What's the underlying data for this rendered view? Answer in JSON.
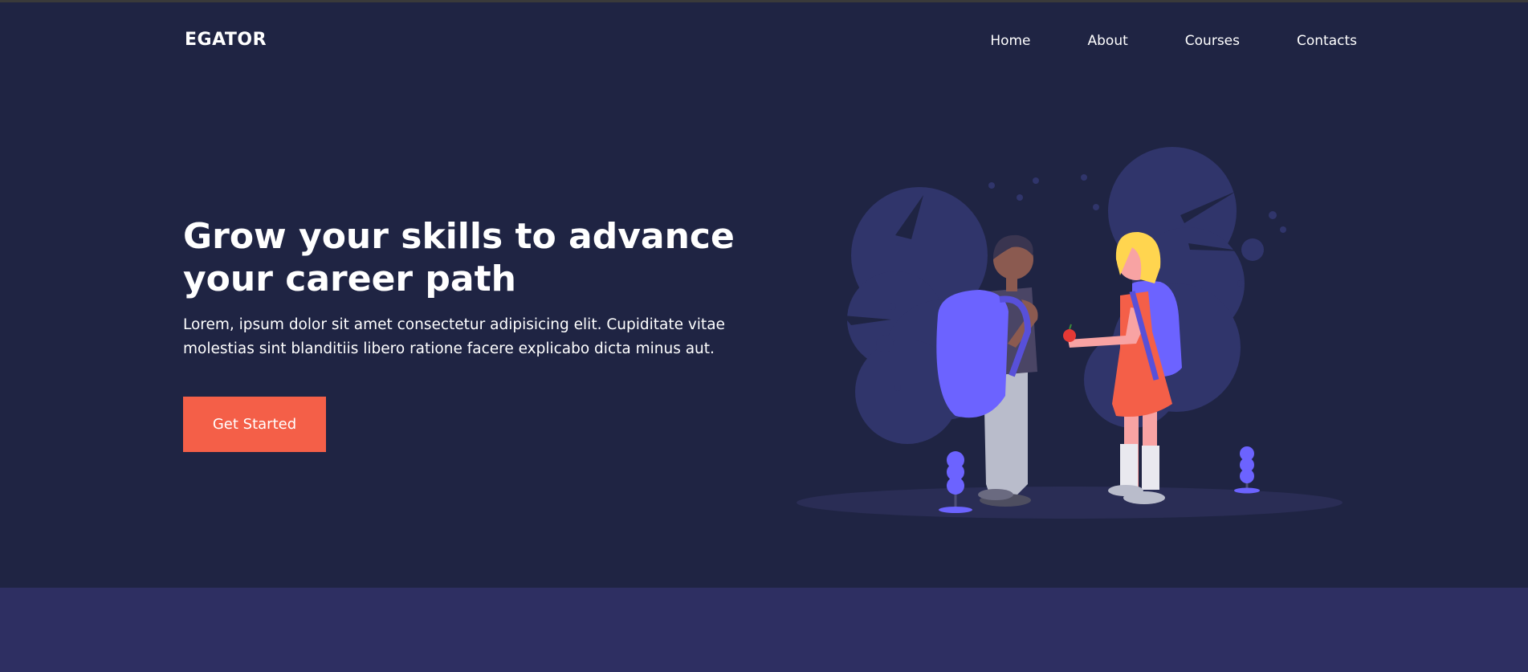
{
  "brand": {
    "logo_text": "EGATOR"
  },
  "nav": {
    "items": [
      {
        "label": "Home"
      },
      {
        "label": "About"
      },
      {
        "label": "Courses"
      },
      {
        "label": "Contacts"
      }
    ]
  },
  "hero": {
    "headline_line1": "Grow your skills to advance",
    "headline_line2": "your career path",
    "subtext_line1": "Lorem, ipsum dolor sit amet consectetur adipisicing elit. Cupiditate vitae",
    "subtext_line2": "molestias sint blanditiis libero ratione facere explicabo dicta minus aut.",
    "cta_label": "Get Started"
  },
  "colors": {
    "hero_bg": "#1f2443",
    "next_section_bg": "#2e2f62",
    "cta_bg": "#f45f48",
    "accent_purple": "#6c63ff"
  }
}
